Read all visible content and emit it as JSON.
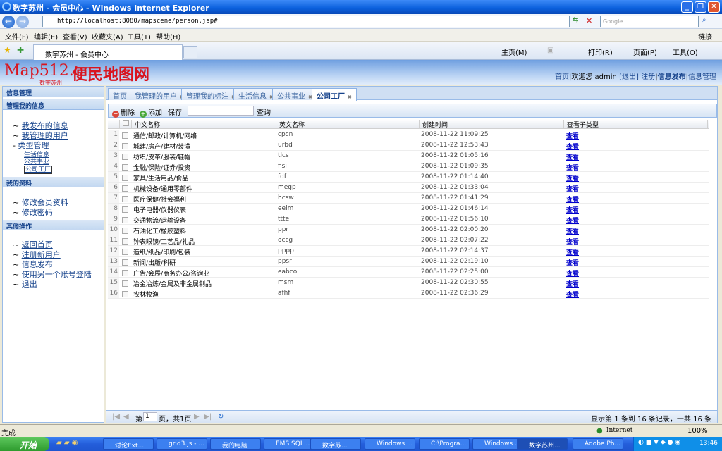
{
  "window": {
    "title": "数字苏州 - 会员中心 - Windows Internet Explorer",
    "url": "http://localhost:8080/mapscene/person.jsp#",
    "search_placeholder": "Google"
  },
  "menu": [
    "文件(F)",
    "编辑(E)",
    "查看(V)",
    "收藏夹(A)",
    "工具(T)",
    "帮助(H)"
  ],
  "menu_links": "链接",
  "browser_tab": "数字苏州 - 会员中心",
  "commands": {
    "home": "主页(M)",
    "print": "打印(R)",
    "page": "页面(P)",
    "tools": "工具(O)"
  },
  "header": {
    "logo": "Map512.cn",
    "logo_sub": "数字苏州",
    "logo_cn": "便民地图网",
    "home": "首页",
    "welcome": "欢迎您 admin",
    "logout": "[退出]",
    "register": "注册",
    "publish": "信息发布",
    "manage": "信息管理"
  },
  "sidebar": {
    "title": "信息管理",
    "sections": [
      {
        "title": "管理我的信息",
        "items": [
          "我发布的信息",
          "我管理的用户",
          "类型管理"
        ],
        "subitems": [
          "生活信息",
          "公共事业",
          "公司工厂"
        ]
      },
      {
        "title": "我的资料",
        "items": [
          "修改会员资料",
          "修改密码"
        ]
      },
      {
        "title": "其他操作",
        "items": [
          "返回首页",
          "注册新用户",
          "信息发布",
          "使用另一个账号登陆",
          "退出"
        ]
      }
    ]
  },
  "tabs": [
    {
      "label": "首页"
    },
    {
      "label": "我管理的用户"
    },
    {
      "label": "管理我的标注"
    },
    {
      "label": "生活信息"
    },
    {
      "label": "公共事业"
    },
    {
      "label": "公司工厂",
      "active": true
    }
  ],
  "toolbar": {
    "delete": "删除",
    "add": "添加",
    "save": "保存",
    "query": "查询",
    "query_value": ""
  },
  "grid": {
    "columns": [
      "中文名称",
      "英文名称",
      "创建时间",
      "查看子类型"
    ],
    "link_label": "查看",
    "rows": [
      [
        "1",
        "通信/邮政/计算机/网络",
        "cpcn",
        "2008-11-22 11:09:25"
      ],
      [
        "2",
        "城建/房产/建材/装潢",
        "urbd",
        "2008-11-22 12:53:43"
      ],
      [
        "3",
        "纺织/皮革/服装/鞋帽",
        "tlcs",
        "2008-11-22 01:05:16"
      ],
      [
        "4",
        "金融/保险/证券/投资",
        "fisi",
        "2008-11-22 01:09:35"
      ],
      [
        "5",
        "家具/生活用品/食品",
        "fdf",
        "2008-11-22 01:14:40"
      ],
      [
        "6",
        "机械设备/通用零部件",
        "megp",
        "2008-11-22 01:33:04"
      ],
      [
        "7",
        "医疗保健/社会福利",
        "hcsw",
        "2008-11-22 01:41:29"
      ],
      [
        "8",
        "电子电器/仪器仪表",
        "eeim",
        "2008-11-22 01:46:14"
      ],
      [
        "9",
        "交通物流/运输设备",
        "ttte",
        "2008-11-22 01:56:10"
      ],
      [
        "10",
        "石油化工/橡胶塑料",
        "ppr",
        "2008-11-22 02:00:20"
      ],
      [
        "11",
        "钟表眼镜/工艺品/礼品",
        "occg",
        "2008-11-22 02:07:22"
      ],
      [
        "12",
        "造纸/纸品/印刷/包装",
        "pppp",
        "2008-11-22 02:14:37"
      ],
      [
        "13",
        "新闻/出版/科研",
        "ppsr",
        "2008-11-22 02:19:10"
      ],
      [
        "14",
        "广告/会展/商务办公/咨询业",
        "eabco",
        "2008-11-22 02:25:00"
      ],
      [
        "15",
        "冶金冶炼/金属及非金属制品",
        "msm",
        "2008-11-22 02:30:55"
      ],
      [
        "16",
        "农林牧渔",
        "afhf",
        "2008-11-22 02:36:29"
      ]
    ]
  },
  "pager": {
    "page_prefix": "第",
    "page": "1",
    "page_suffix": "页，共1页",
    "summary": "显示第 1 条到 16 条记录，一共 16 条"
  },
  "status": {
    "text": "完成",
    "zone": "Internet",
    "zoom": "100%"
  },
  "taskbar": {
    "start": "开始",
    "tasks": [
      "讨论Ext...",
      "grid3.js - ...",
      "我的电脑",
      "EMS SQL ...",
      "数字苏...",
      "Windows ...",
      "C:\\Progra...",
      "Windows ...",
      "数字苏州...",
      "Adobe Ph..."
    ],
    "active_task": 8,
    "clock": "13:46"
  }
}
